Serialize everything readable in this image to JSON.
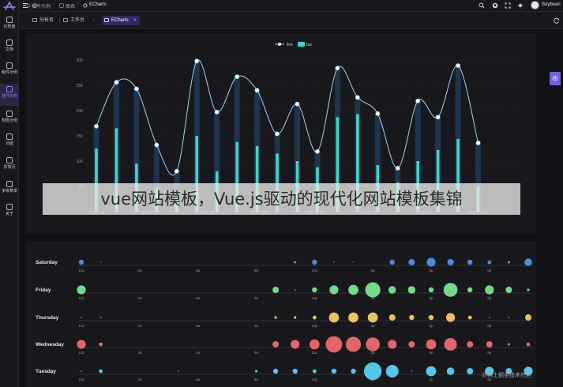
{
  "sidebar": {
    "items": [
      {
        "label": "仪表盘",
        "icon": "dashboard-icon"
      },
      {
        "label": "文档",
        "icon": "document-icon"
      },
      {
        "label": "组件示例",
        "icon": "component-icon"
      },
      {
        "label": "插件示例",
        "icon": "plugin-icon"
      },
      {
        "label": "权限示例",
        "icon": "permission-icon"
      },
      {
        "label": "功能",
        "icon": "function-icon"
      },
      {
        "label": "异常页",
        "icon": "exception-icon"
      },
      {
        "label": "多级菜单",
        "icon": "menu-icon"
      },
      {
        "label": "关于",
        "icon": "about-icon"
      }
    ],
    "active_index": 3
  },
  "header": {
    "breadcrumbs": [
      "插件示例",
      "图表",
      "ECharts"
    ],
    "user_name": "Soybean"
  },
  "tabs": {
    "items": [
      "分析页",
      "工作台",
      "ECharts"
    ],
    "active_index": 2,
    "close_glyph": "×"
  },
  "caption": "vue网站模板，Vue.js驱动的现代化网站模板集锦",
  "watermark": "@稀土掘金技术社区",
  "colors": {
    "accent": "#6d63e0",
    "line": "#9fd0f5",
    "bar": "#3fd6c8",
    "saturday": "#4a8be0",
    "friday": "#74d98a",
    "thursday": "#e8c45e",
    "wednesday": "#e0666a",
    "tuesday": "#55c5e8"
  },
  "chart_data": [
    {
      "type": "line",
      "legend": [
        "line",
        "bar"
      ],
      "legend_position": "top-center",
      "y_ticks": [
        "300",
        "250",
        "200",
        "150",
        "100",
        "50"
      ],
      "x_labels": [
        "2022-6-8",
        "2022-6-13",
        "2022-6-18",
        "2022-6-23",
        "2022-6-28",
        "2022-7-3",
        "2022-7-8",
        "2022-7-13"
      ],
      "x_label_index": [
        0,
        4,
        8,
        12,
        16,
        20,
        24,
        28
      ],
      "ylim": [
        0,
        300
      ],
      "series": [
        {
          "name": "line",
          "values": [
            169,
            256,
            243,
            132,
            80,
            298,
            197,
            267,
            240,
            154,
            213,
            119,
            284,
            226,
            194,
            86,
            219,
            187,
            289,
            136
          ]
        },
        {
          "name": "bar",
          "values": [
            125,
            165,
            95,
            48,
            28,
            150,
            80,
            138,
            130,
            115,
            100,
            88,
            187,
            193,
            92,
            58,
            100,
            122,
            144,
            50
          ]
        }
      ]
    },
    {
      "type": "scatter",
      "y_categories": [
        "Saturday",
        "Friday",
        "Thursday",
        "Wednesday",
        "Tuesday"
      ],
      "x_tick_labels": [
        "12a",
        "3a",
        "6a",
        "9a",
        "12p",
        "3p",
        "6p",
        "9p"
      ],
      "x_range": [
        0,
        23
      ],
      "series": [
        {
          "name": "Saturday",
          "values": [
            [
              0,
              4
            ],
            [
              1,
              1
            ],
            [
              11,
              2
            ],
            [
              12,
              4
            ],
            [
              13,
              1
            ],
            [
              14,
              1
            ],
            [
              16,
              4
            ],
            [
              17,
              5
            ],
            [
              18,
              7
            ],
            [
              19,
              5
            ],
            [
              20,
              4
            ],
            [
              21,
              3
            ],
            [
              22,
              2
            ],
            [
              23,
              6
            ]
          ]
        },
        {
          "name": "Friday",
          "values": [
            [
              0,
              7
            ],
            [
              10,
              5
            ],
            [
              11,
              1
            ],
            [
              12,
              4
            ],
            [
              13,
              7
            ],
            [
              14,
              8
            ],
            [
              15,
              12
            ],
            [
              16,
              6
            ],
            [
              17,
              6
            ],
            [
              18,
              4
            ],
            [
              19,
              11
            ],
            [
              20,
              4
            ],
            [
              21,
              7
            ],
            [
              22,
              5
            ],
            [
              23,
              2
            ]
          ]
        },
        {
          "name": "Thursday",
          "values": [
            [
              0,
              1
            ],
            [
              1,
              1
            ],
            [
              10,
              2
            ],
            [
              11,
              2
            ],
            [
              12,
              3
            ],
            [
              13,
              8
            ],
            [
              14,
              8
            ],
            [
              15,
              8
            ],
            [
              16,
              5
            ],
            [
              17,
              4
            ],
            [
              18,
              4
            ],
            [
              19,
              7
            ],
            [
              20,
              3
            ],
            [
              21,
              1
            ],
            [
              22,
              1
            ],
            [
              23,
              5
            ]
          ]
        },
        {
          "name": "Wednesday",
          "values": [
            [
              0,
              7
            ],
            [
              1,
              3
            ],
            [
              10,
              5
            ],
            [
              11,
              7
            ],
            [
              12,
              8
            ],
            [
              13,
              13
            ],
            [
              14,
              12
            ],
            [
              15,
              11
            ],
            [
              16,
              7
            ],
            [
              17,
              5
            ],
            [
              18,
              8
            ],
            [
              19,
              10
            ],
            [
              20,
              5
            ],
            [
              21,
              5
            ],
            [
              22,
              2
            ],
            [
              23,
              3
            ]
          ]
        },
        {
          "name": "Tuesday",
          "values": [
            [
              0,
              1
            ],
            [
              1,
              3
            ],
            [
              5,
              1
            ],
            [
              9,
              2
            ],
            [
              10,
              4
            ],
            [
              11,
              4
            ],
            [
              12,
              3
            ],
            [
              13,
              4
            ],
            [
              14,
              4
            ],
            [
              15,
              14
            ],
            [
              16,
              10
            ],
            [
              17,
              1
            ],
            [
              18,
              8
            ],
            [
              19,
              6
            ],
            [
              20,
              5
            ],
            [
              21,
              7
            ],
            [
              22,
              5
            ],
            [
              23,
              7
            ]
          ]
        }
      ]
    }
  ]
}
